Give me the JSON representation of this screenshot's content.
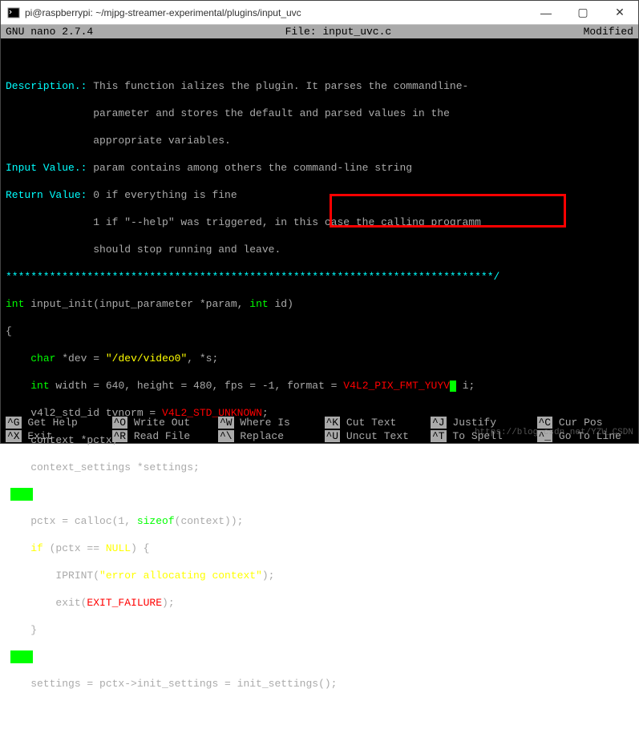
{
  "window": {
    "title": "pi@raspberrypi: ~/mjpg-streamer-experimental/plugins/input_uvc",
    "min": "—",
    "max": "▢",
    "close": "✕"
  },
  "status": {
    "left": "  GNU nano 2.7.4",
    "center": "File: input_uvc.c",
    "right": "Modified "
  },
  "code": {
    "l1a": "Description.:",
    "l1b": " This function ializes the plugin. It parses the commandline-",
    "l2": "              parameter and stores the default and parsed values in the",
    "l3": "              appropriate variables.",
    "l4a": "Input Value.:",
    "l4b": " param contains among others the command-line string",
    "l5a": "Return Value:",
    "l5b": " 0 if everything is fine",
    "l6": "              1 if \"--help\" was triggered, in this case the calling programm",
    "l7": "              should stop running and leave.",
    "l8": "******************************************************************************/",
    "int": "int",
    "fn": " input_init(input_parameter *param, ",
    "id": " id)",
    "ob": "{",
    "char": "char",
    "l10b": " *dev = ",
    "str1": "\"/dev/video0\"",
    "l10c": ", *s;",
    "l11b": " width = 640, height = 480, fps = -1, format = ",
    "fmt": "V4L2_PIX_FMT_YUYV",
    "l11c": " i;",
    "l12a": "    v4l2_std_id tvnorm = ",
    "l12b": "V4L2_STD_UNKNOWN",
    "l12c": ";",
    "l13": "    context *pctx;",
    "l14": "    context_settings *settings;",
    "l16a": "    pctx = calloc(1, ",
    "sizeof": "sizeof",
    "l16b": "(context));",
    "if": "if",
    "l17a": " (pctx == ",
    "null": "NULL",
    "l17b": ") {",
    "l18a": "        IPRINT(",
    "l18b": "\"error allocating context\"",
    "l18c": ");",
    "l19a": "        exit(",
    "l19b": "EXIT_FAILURE",
    "l19c": ");",
    "l20": "    }",
    "l22": "    settings = pctx->init_settings = init_settings();"
  },
  "shortcuts": {
    "r1": [
      {
        "k": "^G",
        "t": " Get Help"
      },
      {
        "k": "^O",
        "t": " Write Out"
      },
      {
        "k": "^W",
        "t": " Where Is"
      },
      {
        "k": "^K",
        "t": " Cut Text"
      },
      {
        "k": "^J",
        "t": " Justify"
      },
      {
        "k": "^C",
        "t": " Cur Pos"
      }
    ],
    "r2": [
      {
        "k": "^X",
        "t": " Exit"
      },
      {
        "k": "^R",
        "t": " Read File"
      },
      {
        "k": "^\\",
        "t": " Replace"
      },
      {
        "k": "^U",
        "t": " Uncut Text"
      },
      {
        "k": "^T",
        "t": " To Spell"
      },
      {
        "k": "^_",
        "t": " Go To Line"
      }
    ]
  },
  "watermark": "https://blog.csdn.net/YZW_CSDN"
}
